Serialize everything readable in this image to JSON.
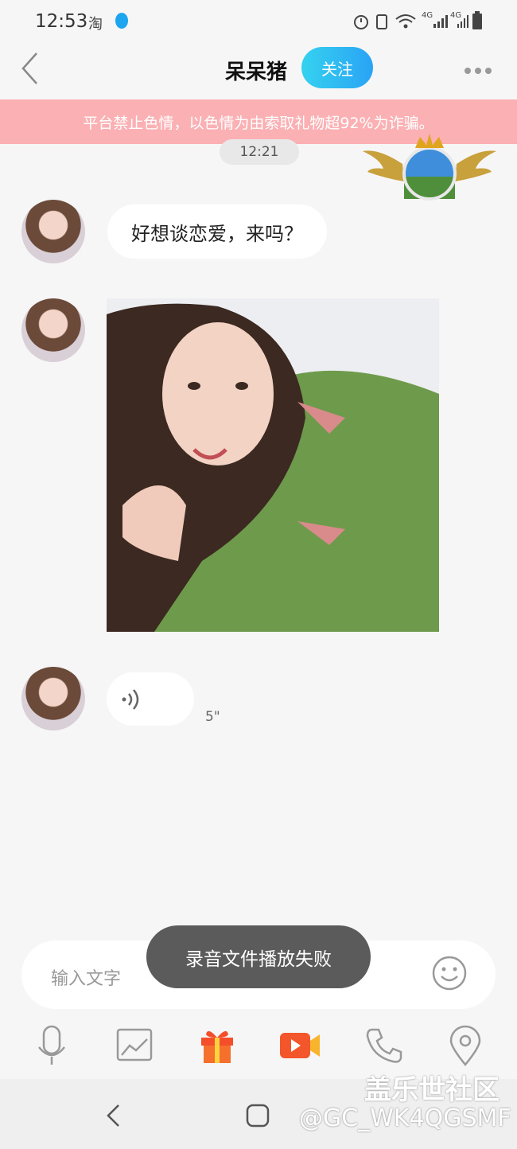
{
  "status_bar": {
    "time": "12:53",
    "net1": "4G",
    "net2": "4G"
  },
  "header": {
    "name": "呆呆猪",
    "follow_label": "关注"
  },
  "banner": {
    "text": "平台禁止色情，以色情为由索取礼物超92%为诈骗。"
  },
  "chat": {
    "timestamp": "12:21",
    "messages": [
      {
        "type": "text",
        "text": "好想谈恋爱，来吗？"
      },
      {
        "type": "image"
      },
      {
        "type": "voice",
        "duration": "5\""
      }
    ]
  },
  "composer": {
    "placeholder": "输入文字"
  },
  "toast": {
    "text": "录音文件播放失败"
  },
  "toolbar": [
    "mic-icon",
    "image-icon",
    "gift-icon",
    "video-icon",
    "phone-icon",
    "location-icon"
  ],
  "watermark": {
    "line1": "盖乐世社区",
    "line2": "@GC_WK4QGSMF"
  },
  "colors": {
    "follow_start": "#35d2ef",
    "follow_end": "#2aa3f5",
    "banner": "#fbb0b3",
    "toast": "#5b5b5b"
  }
}
